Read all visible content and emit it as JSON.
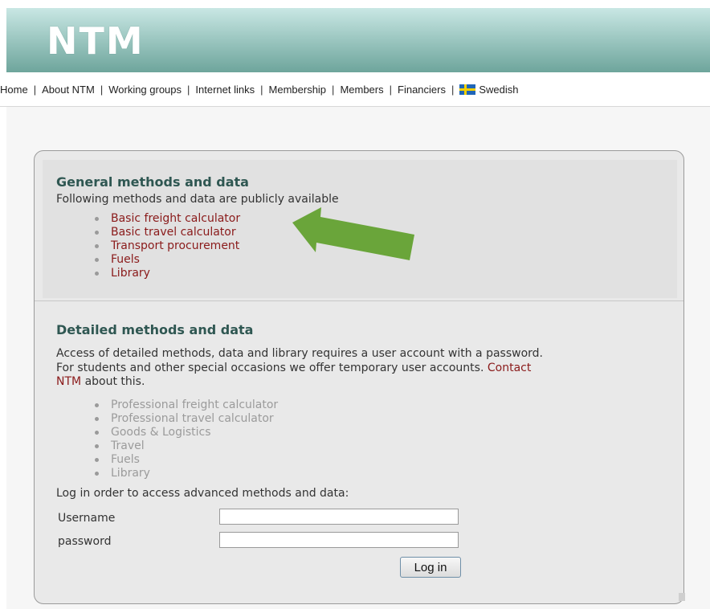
{
  "header": {
    "logo": "NTM"
  },
  "nav": {
    "items": [
      "Home",
      "About NTM",
      "Working groups",
      "Internet links",
      "Membership",
      "Members",
      "Financiers",
      "Swedish"
    ],
    "separator": "|"
  },
  "general": {
    "heading": "General methods and data",
    "intro": "Following methods and data are publicly available",
    "links": [
      "Basic freight calculator",
      "Basic travel calculator",
      "Transport procurement",
      "Fuels",
      "Library"
    ]
  },
  "detailed": {
    "heading": "Detailed methods and data",
    "text_line1": "Access of detailed methods, data and library requires a user account with a password.",
    "text_line2": "For students and other special occasions we offer temporary user accounts.",
    "contact_link": "Contact",
    "text_line3_link": "NTM",
    "text_line3_rest": "about this.",
    "items": [
      "Professional freight calculator",
      "Professional travel calculator",
      "Goods & Logistics",
      "Travel",
      "Fuels",
      "Library"
    ]
  },
  "login": {
    "prompt": "Log in order to access advanced methods and data:",
    "username_label": "Username",
    "password_label": "password",
    "username_value": "",
    "password_value": "",
    "button": "Log in"
  },
  "colors": {
    "link": "#8a1a1a",
    "heading": "#2f5752",
    "arrow": "#6aa53a",
    "inactive": "#9b9b9b"
  }
}
